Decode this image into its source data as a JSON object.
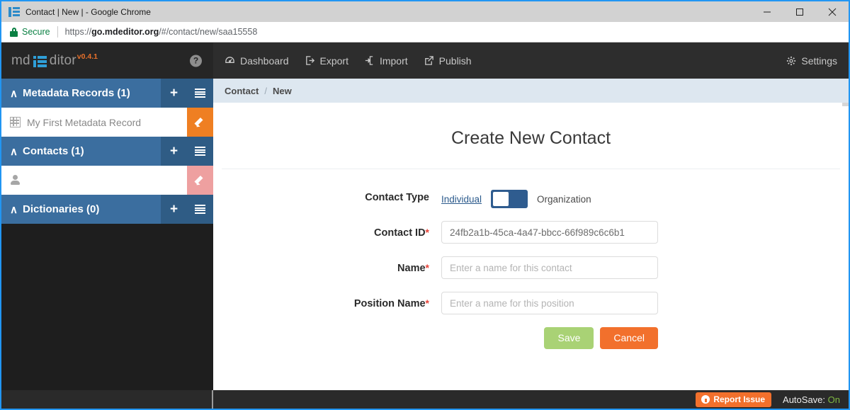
{
  "browser": {
    "tab_title": "Contact | New | - Google Chrome",
    "favicon": "mdeditor-list-icon",
    "security_label": "Secure",
    "url_prefix": "https://",
    "url_host": "go.mdeditor.org",
    "url_path": "/#/contact/new/saa15558",
    "window_controls": [
      "minimize",
      "maximize",
      "close"
    ]
  },
  "sidebar": {
    "brand": {
      "text_a": "md",
      "text_b": "ditor",
      "version": "v0.4.1",
      "icon": "list-icon"
    },
    "help_icon": "?",
    "groups": [
      {
        "title": "Metadata Records (1)",
        "caret": "∧",
        "add_icon": "plus-icon",
        "list_icon": "list-icon",
        "items": [
          {
            "label": "My First Metadata Record",
            "icon": "table-icon",
            "edit_color": "#ef7f22"
          }
        ]
      },
      {
        "title": "Contacts (1)",
        "caret": "∧",
        "add_icon": "plus-icon",
        "list_icon": "list-icon",
        "items": [
          {
            "label": "",
            "icon": "person-icon",
            "edit_color": "#eea0a0"
          }
        ]
      },
      {
        "title": "Dictionaries (0)",
        "caret": "∧",
        "add_icon": "plus-icon",
        "list_icon": "list-icon",
        "items": []
      }
    ]
  },
  "topnav": {
    "items": [
      {
        "label": "Dashboard",
        "icon": "dashboard-icon"
      },
      {
        "label": "Export",
        "icon": "export-icon"
      },
      {
        "label": "Import",
        "icon": "import-icon"
      },
      {
        "label": "Publish",
        "icon": "publish-icon"
      }
    ],
    "settings": {
      "label": "Settings",
      "icon": "gear-icon"
    }
  },
  "breadcrumb": {
    "parent": "Contact",
    "separator": "/",
    "current": "New"
  },
  "page": {
    "title": "Create New Contact",
    "fields": {
      "contact_type": {
        "label": "Contact Type",
        "option_left": "Individual",
        "option_right": "Organization",
        "selected": "Individual"
      },
      "contact_id": {
        "label": "Contact ID",
        "required": "*",
        "value": "24fb2a1b-45ca-4a47-bbcc-66f989c6c6b1",
        "placeholder": ""
      },
      "name": {
        "label": "Name",
        "required": "*",
        "value": "",
        "placeholder": "Enter a name for this contact"
      },
      "position_name": {
        "label": "Position Name",
        "required": "*",
        "value": "",
        "placeholder": "Enter a name for this position"
      }
    },
    "buttons": {
      "save": "Save",
      "cancel": "Cancel"
    }
  },
  "footer": {
    "report_label": "Report Issue",
    "report_icon": "github-icon",
    "autosave_label": "AutoSave:",
    "autosave_state": "On"
  },
  "colors": {
    "accent_orange": "#f2702c",
    "sidebar_header_blue": "#3b6e9f",
    "sidebar_action_blue": "#2f5c85",
    "save_green": "#a9d275",
    "window_border_blue": "#2196f3",
    "autosave_green": "#7fb842"
  }
}
